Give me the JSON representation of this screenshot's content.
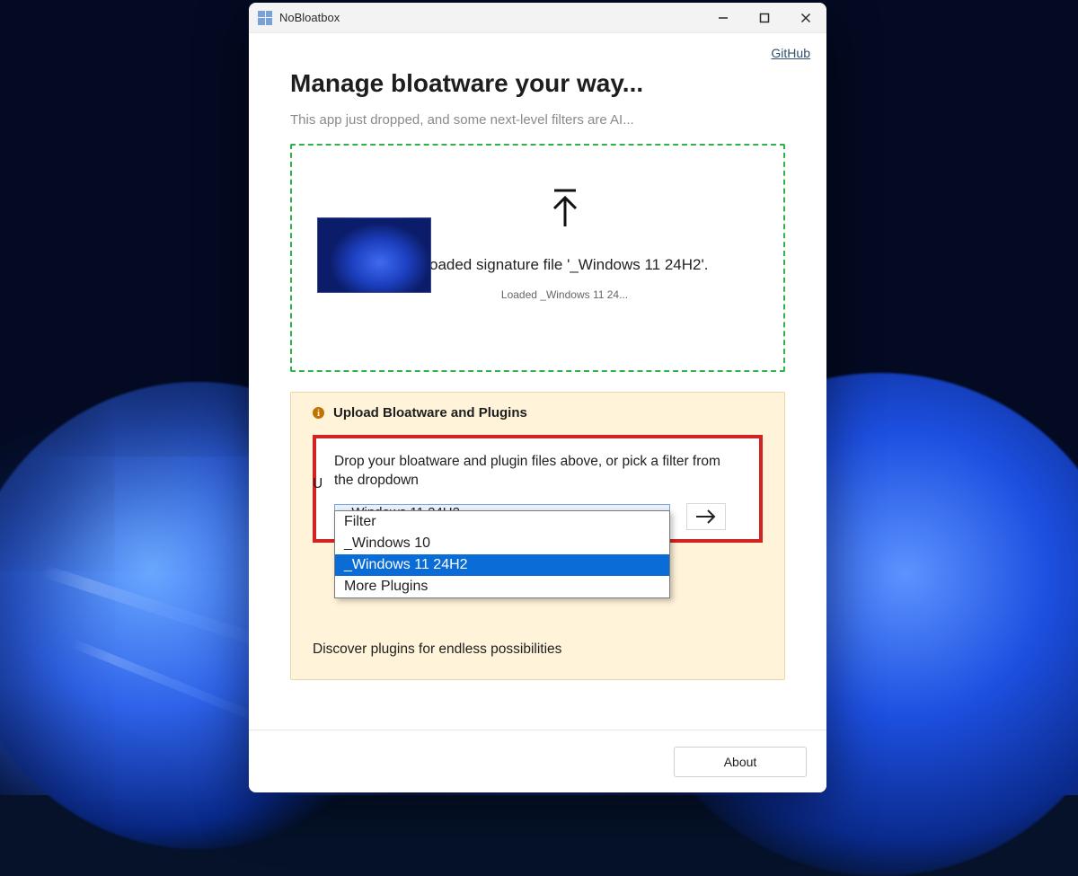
{
  "window": {
    "title": "NoBloatbox"
  },
  "header": {
    "github_link": "GitHub",
    "heading": "Manage bloatware your way...",
    "subheading": "This app just dropped, and some next-level filters are AI..."
  },
  "dropzone": {
    "message": "Loaded signature file '_Windows 11 24H2'.",
    "loaded_short": "Loaded _Windows 11 24..."
  },
  "panel": {
    "title": "Upload Bloatware and Plugins",
    "instruction": "Drop your bloatware and plugin files above, or pick a filter from the dropdown",
    "combo_selected": "_Windows 11 24H2",
    "dropdown_options": {
      "o0": "Filter",
      "o1": "_Windows 10",
      "o2": "_Windows 11 24H2",
      "o3": "More Plugins"
    },
    "partially_hidden_left": "U",
    "discover": "Discover plugins for endless possibilities"
  },
  "footer": {
    "about_label": "About"
  }
}
